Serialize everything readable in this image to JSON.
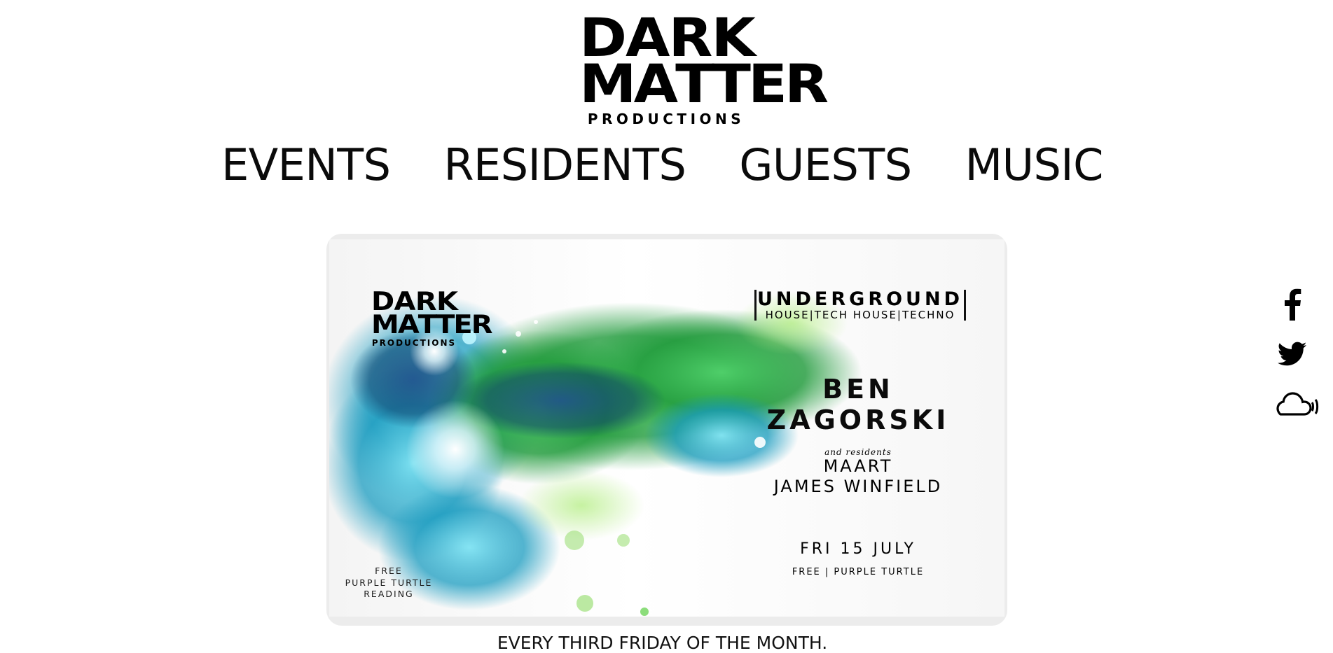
{
  "header": {
    "logo_line1": [
      "D",
      "A",
      "R",
      "K"
    ],
    "logo_line2": [
      "M",
      "A",
      "T",
      "T",
      "E",
      "R"
    ],
    "logo_sub": "PRODUCTIONS"
  },
  "nav": {
    "items": [
      {
        "label": "EVENTS"
      },
      {
        "label": "RESIDENTS"
      },
      {
        "label": "GUESTS"
      },
      {
        "label": "MUSIC"
      }
    ]
  },
  "flyer": {
    "logo_line1": [
      "D",
      "A",
      "R",
      "K"
    ],
    "logo_line2": [
      "M",
      "A",
      "T",
      "T",
      "E",
      "R"
    ],
    "logo_sub": "PRODUCTIONS",
    "genre_title": "UNDERGROUND",
    "genre_sub": "HOUSE|TECH HOUSE|TECHNO",
    "headliner": "BEN ZAGORSKI",
    "and_residents": "and residents",
    "residents": [
      "MAART",
      "JAMES WINFIELD"
    ],
    "date": "FRI 15 JULY",
    "venue": "FREE | PURPLE TURTLE",
    "left_note": [
      "FREE",
      "PURPLE TURTLE",
      "READING"
    ],
    "colors": {
      "green": "#2fa72a",
      "teal": "#1aa0b8",
      "navy": "#0d3d7a"
    }
  },
  "tagline": "EVERY THIRD FRIDAY OF THE MONTH.",
  "social": {
    "icons": [
      "facebook-icon",
      "twitter-icon",
      "soundcloud-icon"
    ]
  }
}
